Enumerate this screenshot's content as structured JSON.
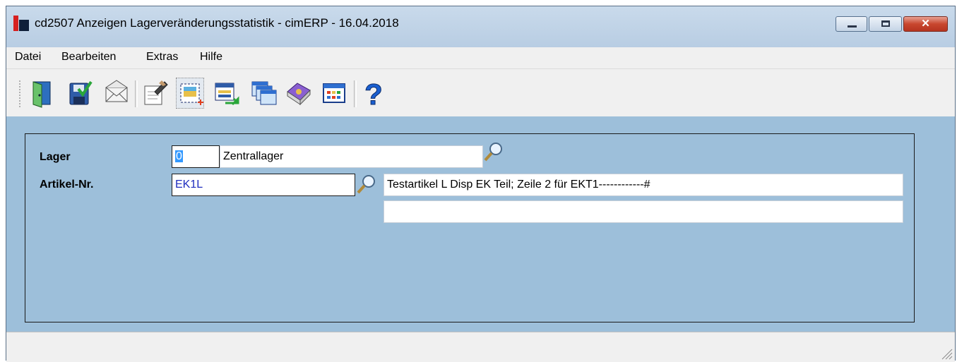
{
  "window": {
    "title": "cd2507 Anzeigen Lagerveränderungsstatistik - cimERP - 16.04.2018",
    "buttons": {
      "minimize": "minimize",
      "maximize": "maximize",
      "close": "x"
    }
  },
  "menu": {
    "items": [
      "Datei",
      "Bearbeiten",
      "Extras",
      "Hilfe"
    ]
  },
  "toolbar": {
    "buttons": [
      "exit-door-icon",
      "save-check-icon",
      "mail-envelope-icon",
      "edit-notepad-icon",
      "new-record-icon",
      "transfer-list-icon",
      "windows-icon",
      "book-icon",
      "calendar-grid-icon",
      "help-question-icon"
    ]
  },
  "form": {
    "lager": {
      "label": "Lager",
      "code": "0",
      "name": "Zentrallager"
    },
    "artikel": {
      "label": "Artikel-Nr.",
      "value": "EK1L",
      "description1": "Testartikel L Disp EK Teil; Zeile 2 für EKT1------------#",
      "description2": ""
    }
  },
  "colors": {
    "background": "#9dbfda",
    "field_text_blue": "#1f2dbf",
    "close_button": "#c8472e"
  }
}
